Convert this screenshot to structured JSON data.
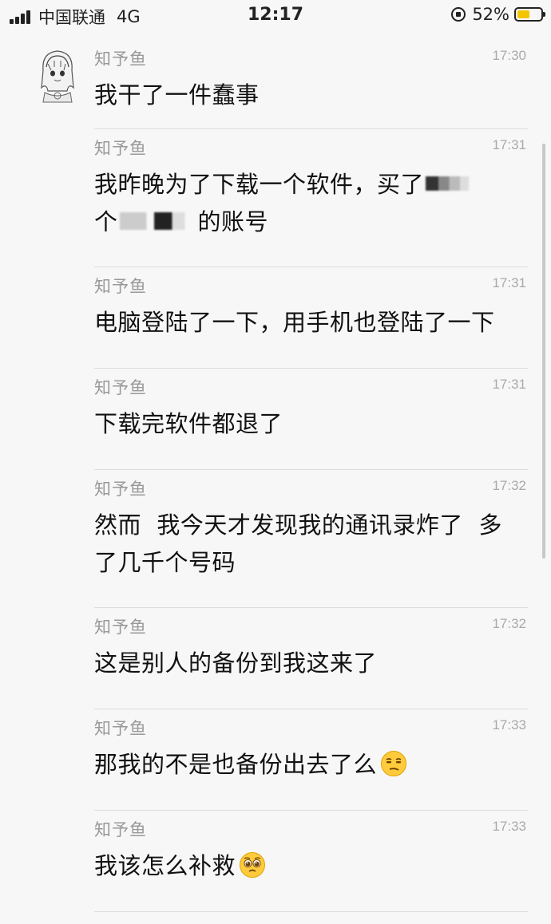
{
  "status_bar": {
    "carrier": "中国联通",
    "network": "4G",
    "time": "12:17",
    "battery": "52%",
    "battery_level": 0.52,
    "accent_battery": "#f5c400"
  },
  "chat": {
    "sender_name": "知予鱼",
    "avatar_icon": "anime-girl-avatar",
    "messages": [
      {
        "time": "17:30",
        "text": "我干了一件蠢事"
      },
      {
        "time": "17:31",
        "text_a": "我昨晚为了下载一个软件，买了",
        "text_b": "个",
        "text_c": "的账号"
      },
      {
        "time": "17:31",
        "text": "电脑登陆了一下，用手机也登陆了一下"
      },
      {
        "time": "17:31",
        "text": "下载完软件都退了"
      },
      {
        "time": "17:32",
        "text_a": "然而  我今天才发现我的通讯录炸了  多",
        "text_b": "了几千个号码"
      },
      {
        "time": "17:32",
        "text": "这是别人的备份到我这来了"
      },
      {
        "time": "17:33",
        "text": "那我的不是也备份出去了么",
        "emoji": "unamused-face-icon"
      },
      {
        "time": "17:33",
        "text": "我该怎么补救",
        "emoji": "pleading-face-icon"
      }
    ]
  }
}
